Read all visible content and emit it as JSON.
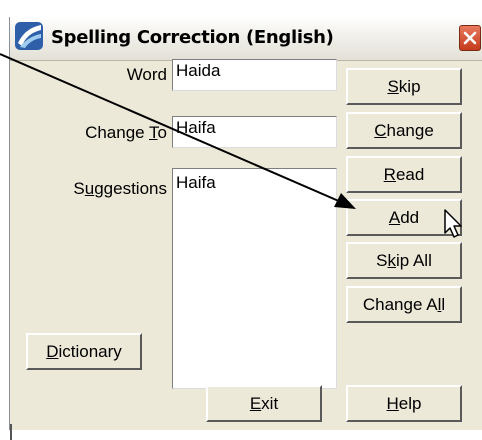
{
  "dialog": {
    "title": "Spelling Correction (English)",
    "app_icon": "app-logo-icon",
    "close_icon": "close-x-icon"
  },
  "form": {
    "word_label": "Word",
    "word_value": "Haida",
    "change_to_label": "Change To",
    "change_to_value": "Haifa",
    "suggestions_label": "Suggestions",
    "suggestions": [
      "Haifa"
    ]
  },
  "buttons": {
    "skip": "Skip",
    "change": "Change",
    "read": "Read",
    "add": "Add",
    "skip_all": "Skip All",
    "change_all": "Change All",
    "dictionary": "Dictionary",
    "exit": "Exit",
    "help": "Help"
  },
  "annotation": {
    "arrow_target": "add-button",
    "cursor": "mouse-pointer-icon"
  }
}
